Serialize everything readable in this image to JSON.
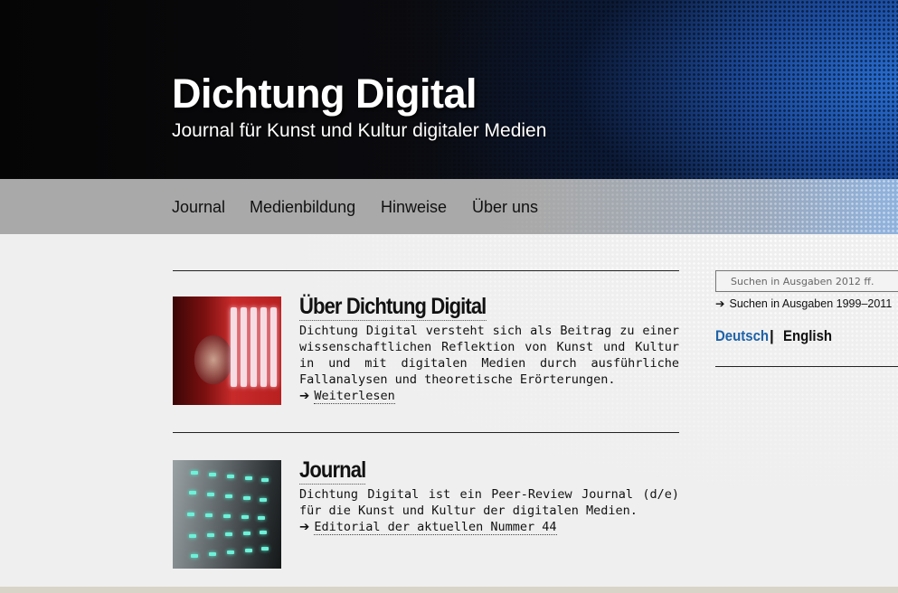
{
  "header": {
    "title": "Dichtung Digital",
    "subtitle": "Journal für Kunst und Kultur digitaler Medien"
  },
  "nav": {
    "items": [
      "Journal",
      "Medienbildung",
      "Hinweise",
      "Über uns"
    ]
  },
  "articles": [
    {
      "title": "Über Dichtung Digital",
      "text": "Dichtung Digital versteht sich als Beitrag zu einer wissenschaftlichen Reflektion von Kunst und Kultur in und mit digitalen Medien durch ausführliche Fallanalysen und theoretische Erörterungen.",
      "link": "Weiterlesen"
    },
    {
      "title": "Journal",
      "text": "Dichtung Digital ist ein Peer-Review Journal (d/e) für die Kunst und Kultur der digitalen Medien.",
      "link": "Editorial der aktuellen Nummer 44"
    }
  ],
  "sidebar": {
    "search_placeholder": "Suchen in Ausgaben 2012 ff.",
    "archive_link": "Suchen in Ausgaben 1999–2011",
    "lang_de": "Deutsch",
    "lang_sep": "|",
    "lang_en": "English"
  },
  "colors": {
    "accent_blue": "#1e62a8",
    "text": "#111111",
    "nav_bg": "#a9a9a9"
  }
}
